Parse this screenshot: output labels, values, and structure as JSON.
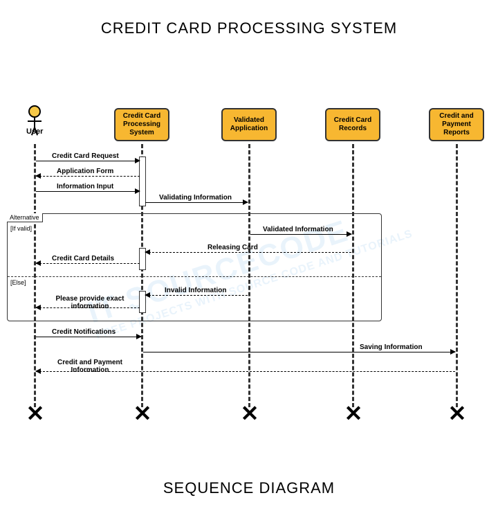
{
  "title": "CREDIT CARD PROCESSING SYSTEM",
  "footer": "SEQUENCE DIAGRAM",
  "actor": {
    "name": "User"
  },
  "lifelines": [
    {
      "label": "Credit Card Processing System"
    },
    {
      "label": "Validated Application"
    },
    {
      "label": "Credit Card Records"
    },
    {
      "label": "Credit and Payment Reports"
    }
  ],
  "messages": {
    "m1": "Credit Card Request",
    "m2": "Application Form",
    "m3": "Information Input",
    "m4": "Validating Information",
    "m5": "Validated Information",
    "m6": "Releasing Card",
    "m7": "Credit Card Details",
    "m8": "Invalid Information",
    "m9": "Please provide exact information",
    "m10": "Credit Notifications",
    "m11": "Saving Information",
    "m12": "Credit and Payment Information"
  },
  "alt": {
    "label": "Alternative",
    "cond_if": "[If valid]",
    "cond_else": "[Else]"
  },
  "watermark": {
    "main": "IT SOURCECODE",
    "sub": "FREE PROJECTS WITH SOURCE CODE AND TUTORIALS"
  }
}
